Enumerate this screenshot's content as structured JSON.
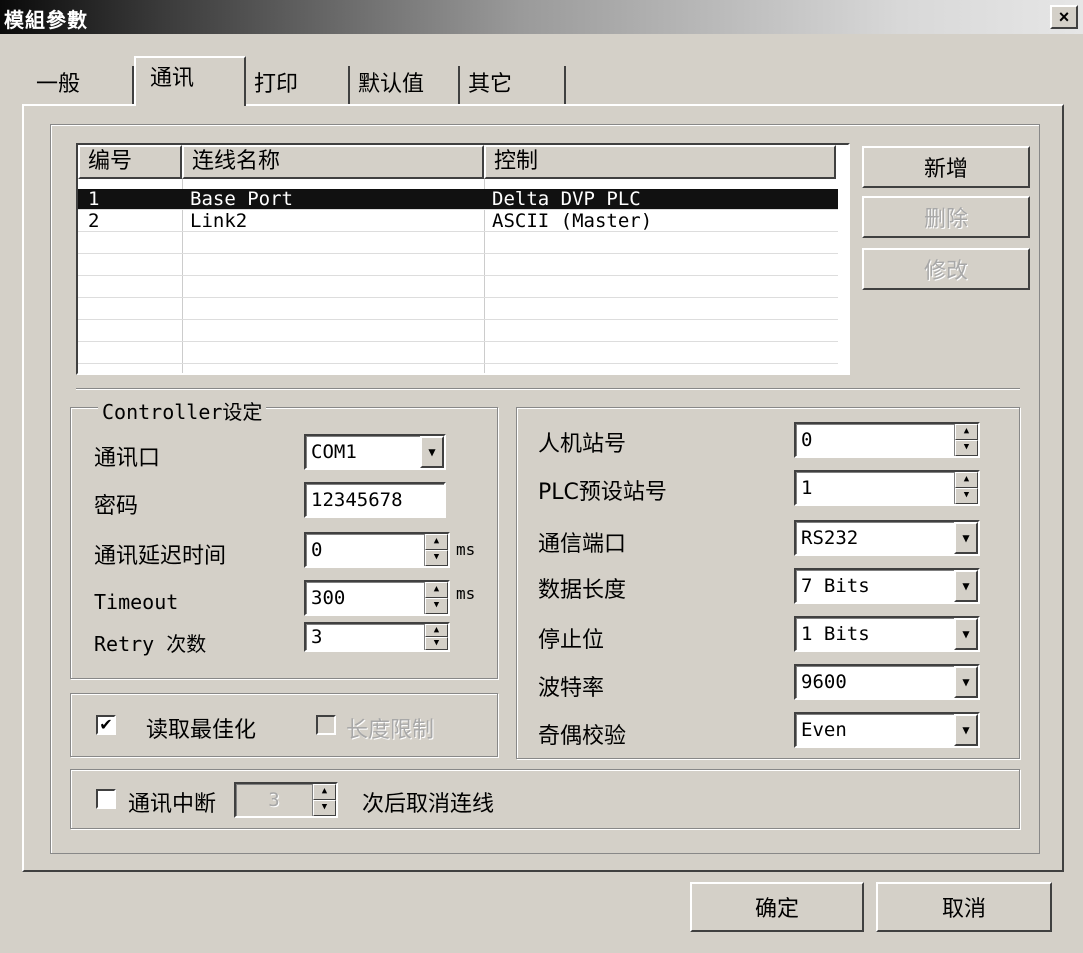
{
  "window": {
    "title": "模組參數",
    "close_label": "×"
  },
  "tabs": [
    {
      "label": "一般"
    },
    {
      "label": "通讯",
      "active": true
    },
    {
      "label": "打印"
    },
    {
      "label": "默认值"
    },
    {
      "label": "其它"
    }
  ],
  "links_table": {
    "headers": [
      "编号",
      "连线名称",
      "控制"
    ],
    "rows": [
      {
        "id": "1",
        "name": "Base Port",
        "control": "Delta DVP PLC",
        "selected": true
      },
      {
        "id": "2",
        "name": "Link2",
        "control": "ASCII (Master)",
        "selected": false
      }
    ]
  },
  "side_buttons": {
    "add": "新增",
    "delete": "删除",
    "modify": "修改"
  },
  "controller": {
    "group_title": "Controller设定",
    "port_label": "通讯口",
    "port_value": "COM1",
    "password_label": "密码",
    "password_value": "12345678",
    "delay_label": "通讯延迟时间",
    "delay_value": "0",
    "delay_unit": "ms",
    "timeout_label": "Timeout",
    "timeout_value": "300",
    "timeout_unit": "ms",
    "retry_label": "Retry 次数",
    "retry_value": "3"
  },
  "options": {
    "optimize_label": "读取最佳化",
    "optimize_checked": true,
    "optimize_mark": "✔",
    "length_label": "长度限制",
    "length_checked": false
  },
  "plc": {
    "hmi_station_label": "人机站号",
    "hmi_station_value": "0",
    "plc_station_label": "PLC预设站号",
    "plc_station_value": "1",
    "comm_port_label": "通信端口",
    "comm_port_value": "RS232",
    "data_length_label": "数据长度",
    "data_length_value": "7 Bits",
    "stop_bit_label": "停止位",
    "stop_bit_value": "1 Bits",
    "baud_label": "波特率",
    "baud_value": "9600",
    "parity_label": "奇偶校验",
    "parity_value": "Even"
  },
  "interrupt": {
    "checkbox_label": "通讯中断",
    "checked": false,
    "count_value": "3",
    "suffix": "次后取消连线"
  },
  "footer": {
    "ok": "确定",
    "cancel": "取消"
  },
  "icons": {
    "spin_up": "▲",
    "spin_down": "▼",
    "dropdown": "▼"
  }
}
